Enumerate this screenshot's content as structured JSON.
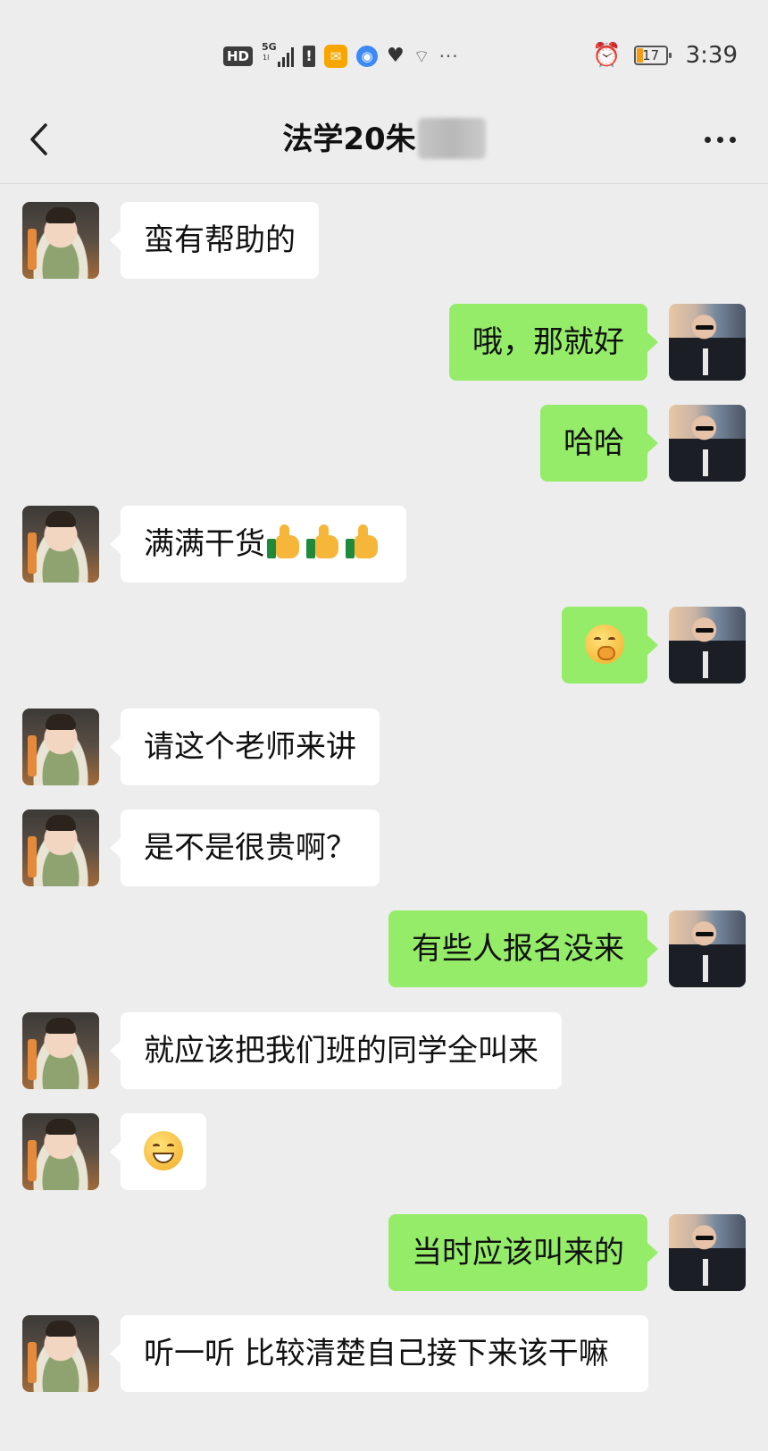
{
  "status_bar": {
    "hd_label": "HD",
    "network_label": "5G",
    "network_sub": "1l",
    "warn_glyph": "!",
    "battery_level": "17",
    "time": "3:39",
    "icons": [
      "hd-icon",
      "signal-icon",
      "warning-icon",
      "mail-icon",
      "browser-icon",
      "health-icon",
      "wifi-icon",
      "more-icon",
      "alarm-icon",
      "battery-icon"
    ]
  },
  "nav": {
    "title": "法学20朱",
    "title_redacted": true,
    "back_icon": "chevron-left-icon",
    "more_icon": "more-dots-icon"
  },
  "colors": {
    "background": "#ededed",
    "outgoing_bubble": "#95ec69",
    "incoming_bubble": "#ffffff"
  },
  "messages": [
    {
      "side": "in",
      "text": "蛮有帮助的"
    },
    {
      "side": "out",
      "text": "哦，那就好"
    },
    {
      "side": "out",
      "text": "哈哈"
    },
    {
      "side": "in",
      "text": "满满干货",
      "emoji": [
        "thumbs-up",
        "thumbs-up",
        "thumbs-up"
      ]
    },
    {
      "side": "out",
      "text": "",
      "emoji": [
        "smirk-face"
      ]
    },
    {
      "side": "in",
      "text": "请这个老师来讲"
    },
    {
      "side": "in",
      "text": "是不是很贵啊？"
    },
    {
      "side": "out",
      "text": "有些人报名没来"
    },
    {
      "side": "in",
      "text": "就应该把我们班的同学全叫来"
    },
    {
      "side": "in",
      "text": "",
      "emoji": [
        "grin-face"
      ]
    },
    {
      "side": "out",
      "text": "当时应该叫来的"
    },
    {
      "side": "in",
      "text": "听一听  比较清楚自己接下来该干嘛"
    }
  ]
}
